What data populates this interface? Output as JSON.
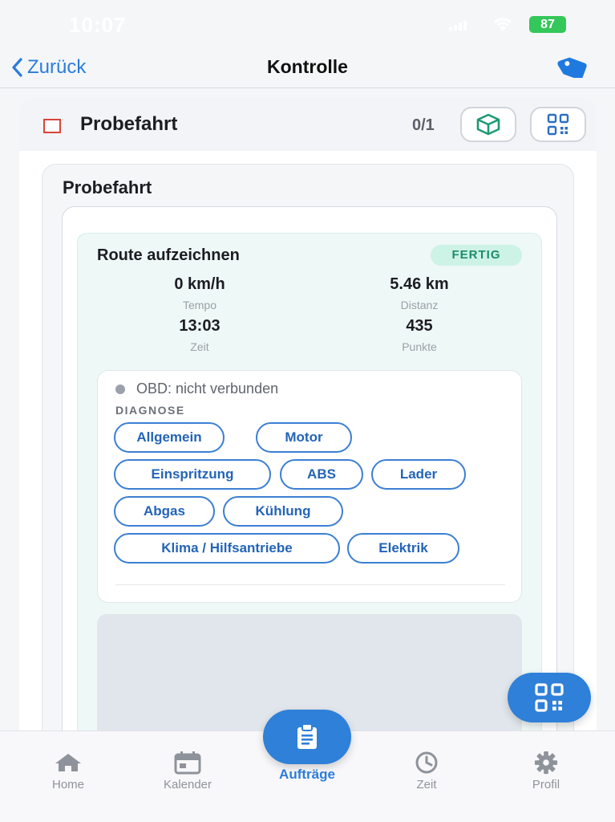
{
  "status_bar": {
    "time": "10:07",
    "battery": "87"
  },
  "nav": {
    "back_label": "Zurück",
    "title": "Kontrolle",
    "tag_icon": "tag-icon"
  },
  "card": {
    "title": "Probefahrt",
    "count": "0/1",
    "box_icon": "box-icon",
    "qr_icon": "qr-code-icon",
    "section": {
      "title": "Probefahrt",
      "route": {
        "title": "Route aufzeichnen",
        "badge": "FERTIG",
        "stats": [
          {
            "value": "0 km/h",
            "label": "Tempo"
          },
          {
            "value": "5.46 km",
            "label": "Distanz"
          },
          {
            "value": "13:03",
            "label": "Zeit"
          },
          {
            "value": "435",
            "label": "Punkte"
          }
        ],
        "obd_status": "OBD: nicht verbunden",
        "diagnose_label": "DIAGNOSE",
        "chips": [
          "Allgemein",
          "Motor",
          "Einspritzung",
          "ABS",
          "Lader",
          "Abgas",
          "Kühlung",
          "Klima / Hilfsantriebe",
          "Elektrik"
        ]
      }
    }
  },
  "fab": {
    "icon": "qr-code-icon"
  },
  "tabbar": {
    "tabs": [
      {
        "label": "Home",
        "icon": "home-icon"
      },
      {
        "label": "Kalender",
        "icon": "calendar-icon"
      },
      {
        "label": "Aufträge",
        "icon": "clipboard-icon",
        "active": true
      },
      {
        "label": "Zeit",
        "icon": "clock-icon"
      },
      {
        "label": "Profil",
        "icon": "gear-icon"
      }
    ]
  },
  "colors": {
    "accent": "#2f80d8",
    "badge_bg": "#cdf2e6",
    "badge_text": "#1b8c6c",
    "checkbox": "#d9453b"
  }
}
